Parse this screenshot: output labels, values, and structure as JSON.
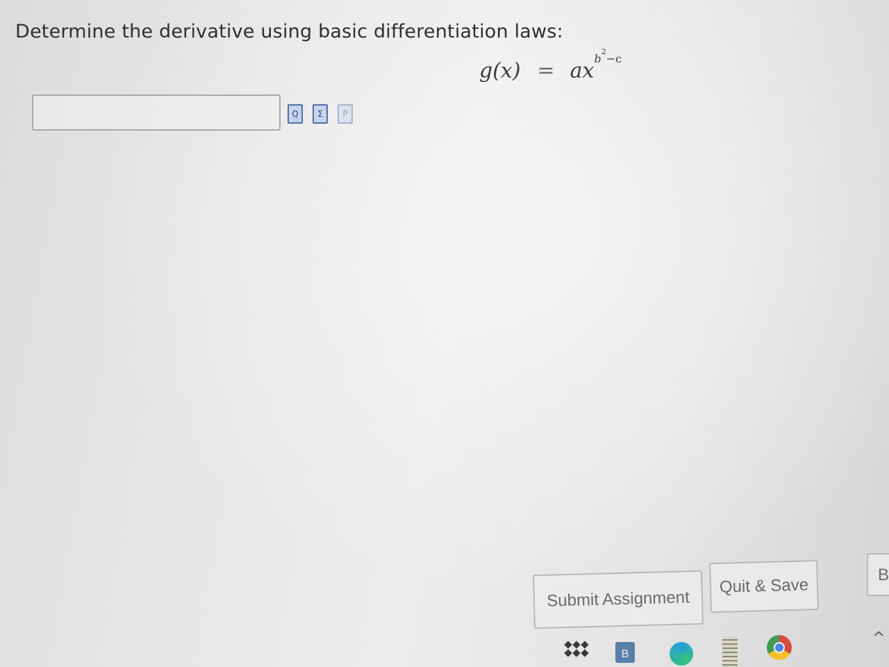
{
  "question": {
    "prompt": "Determine the derivative using basic differentiation laws:",
    "formula": {
      "lhs": "g(x)",
      "equals": "=",
      "rhs_base": "ax",
      "rhs_exp_base": "b",
      "rhs_exp_power": "2",
      "rhs_exp_tail": "−c"
    }
  },
  "answer_input": {
    "value": "",
    "placeholder": ""
  },
  "tools": [
    {
      "icon": "preview-icon",
      "glyph": "Q"
    },
    {
      "icon": "equation-editor-icon",
      "glyph": "Σ"
    },
    {
      "icon": "page-icon",
      "glyph": "P"
    }
  ],
  "buttons": {
    "submit_label": "Submit Assignment",
    "quit_label": "Quit & Save",
    "edge_label": "B"
  },
  "taskbar": {
    "b_label": "B",
    "caret": "^"
  },
  "colors": {
    "page_background": "#e4e4e4",
    "text": "#2f2f2f",
    "tool_accent": "#4d6fa8",
    "button_border": "#b8b8b8"
  }
}
